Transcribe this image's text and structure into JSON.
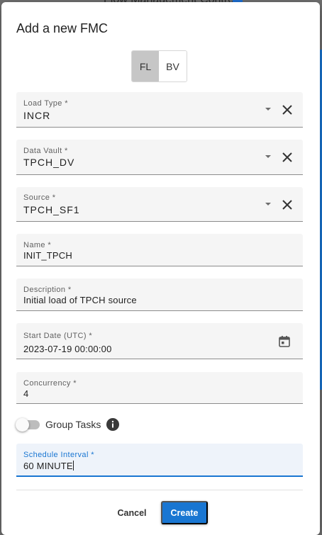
{
  "backdrop": {
    "title": "Flow Management Control"
  },
  "dialog": {
    "title": "Add a new FMC",
    "toggle": {
      "options": [
        "FL",
        "BV"
      ],
      "selected": "FL"
    },
    "fields": {
      "load_type": {
        "label": "Load Type *",
        "value": "INCR"
      },
      "data_vault": {
        "label": "Data Vault *",
        "value": "TPCH_DV"
      },
      "source": {
        "label": "Source *",
        "value": "TPCH_SF1"
      },
      "name": {
        "label": "Name *",
        "value": "INIT_TPCH"
      },
      "description": {
        "label": "Description *",
        "value": "Initial load of TPCH source"
      },
      "start_date": {
        "label": "Start Date (UTC) *",
        "value": "2023-07-19 00:00:00"
      },
      "concurrency": {
        "label": "Concurrency *",
        "value": "4"
      },
      "schedule_interval": {
        "label": "Schedule Interval *",
        "value": "60 MINUTE"
      }
    },
    "group_tasks": {
      "label": "Group Tasks",
      "enabled": false
    },
    "buttons": {
      "cancel": "Cancel",
      "create": "Create"
    },
    "colors": {
      "primary": "#1976d2",
      "toggle_active": "#c6c6c6"
    }
  }
}
